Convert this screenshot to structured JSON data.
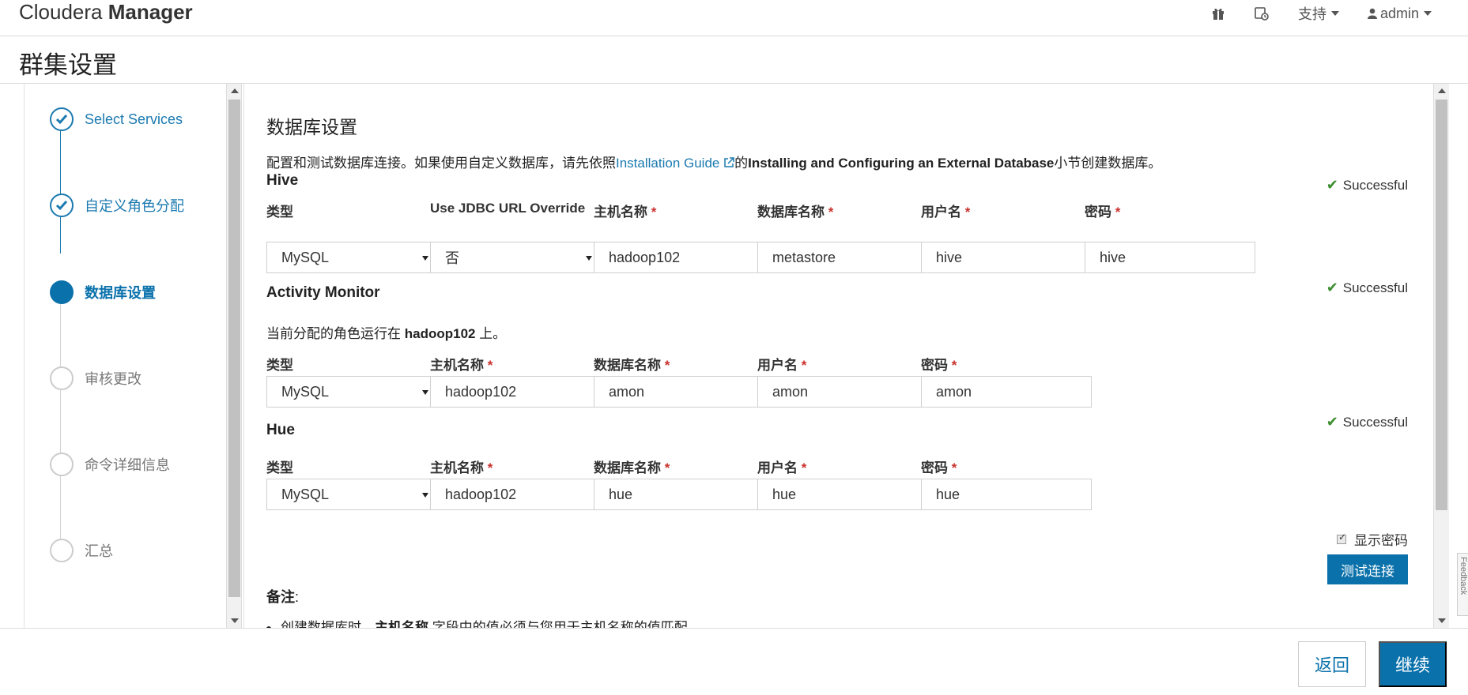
{
  "header": {
    "brand_light": "Cloudera ",
    "brand_bold": "Manager",
    "nav": {
      "gift_icon": "gift-icon",
      "tasks_icon": "running-commands-icon",
      "support": "支持",
      "user": "admin"
    }
  },
  "page_title": "群集设置",
  "steps": [
    {
      "label": "Select Services",
      "state": "done"
    },
    {
      "label": "自定义角色分配",
      "state": "done"
    },
    {
      "label": "数据库设置",
      "state": "active"
    },
    {
      "label": "审核更改",
      "state": "pending"
    },
    {
      "label": "命令详细信息",
      "state": "pending"
    },
    {
      "label": "汇总",
      "state": "pending"
    }
  ],
  "main": {
    "section_title": "数据库设置",
    "intro_prefix": "配置和测试数据库连接。如果使用自定义数据库，请先依照",
    "intro_link": "Installation Guide",
    "intro_mid": "的",
    "intro_bold": "Installing and Configuring an External Database",
    "intro_suffix": "小节创建数据库。",
    "status_text": "Successful",
    "hive": {
      "title": "Hive",
      "labels": {
        "type": "类型",
        "jdbc": "Use JDBC URL Override",
        "host": "主机名称",
        "dbname": "数据库名称",
        "user": "用户名",
        "password": "密码"
      },
      "values": {
        "type": "MySQL",
        "jdbc": "否",
        "host": "hadoop102",
        "dbname": "metastore",
        "user": "hive",
        "password": "hive"
      }
    },
    "amon": {
      "title": "Activity Monitor",
      "note_prefix": "当前分配的角色运行在 ",
      "note_host": "hadoop102",
      "note_suffix": " 上。",
      "labels": {
        "type": "类型",
        "host": "主机名称",
        "dbname": "数据库名称",
        "user": "用户名",
        "password": "密码"
      },
      "values": {
        "type": "MySQL",
        "host": "hadoop102",
        "dbname": "amon",
        "user": "amon",
        "password": "amon"
      }
    },
    "hue": {
      "title": "Hue",
      "labels": {
        "type": "类型",
        "host": "主机名称",
        "dbname": "数据库名称",
        "user": "用户名",
        "password": "密码"
      },
      "values": {
        "type": "MySQL",
        "host": "hadoop102",
        "dbname": "hue",
        "user": "hue",
        "password": "hue"
      }
    },
    "show_password": "显示密码",
    "test_connection": "测试连接",
    "notes_title": "备注",
    "notes_colon": ":",
    "note1_prefix": "创建数据库时，",
    "note1_bold": "主机名称",
    "note1_suffix": " 字段中的值必须与您用于主机名称的值匹配"
  },
  "footer": {
    "back": "返回",
    "next": "继续"
  },
  "feedback": "Feedback",
  "required_mark": "*"
}
